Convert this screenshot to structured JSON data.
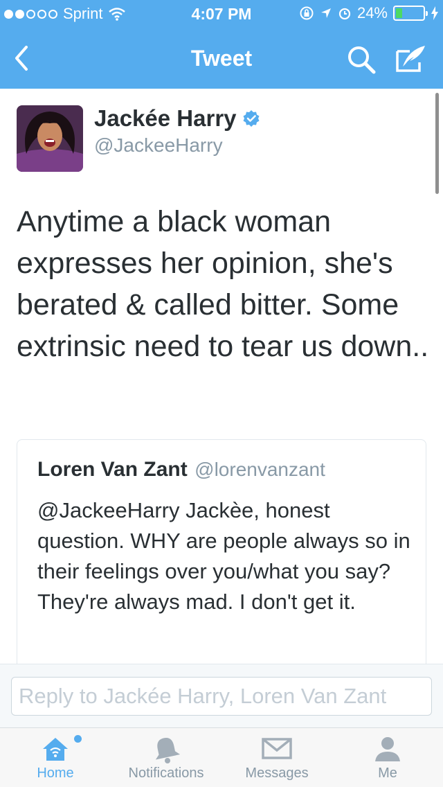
{
  "status_bar": {
    "carrier": "Sprint",
    "time": "4:07 PM",
    "battery_percent": "24%",
    "signal_dots_filled": 2,
    "battery_level": 0.24
  },
  "nav": {
    "title": "Tweet"
  },
  "tweet": {
    "author_name": "Jackée Harry",
    "author_handle": "@JackeeHarry",
    "text": "Anytime a black woman expresses her opinion, she's berated & called bitter. Some extrinsic need to tear us down.."
  },
  "quoted_tweet": {
    "author_name": "Loren Van Zant",
    "author_handle": "@lorenvanzant",
    "text": "@JackeeHarry Jackèe, honest question. WHY are people always so in their feelings over you/what you say? They're always mad. I don't get it."
  },
  "reply": {
    "placeholder": "Reply to Jackée Harry, Loren Van Zant"
  },
  "tabs": [
    {
      "label": "Home",
      "icon": "home-icon",
      "active": true
    },
    {
      "label": "Notifications",
      "icon": "bell-icon",
      "active": false
    },
    {
      "label": "Messages",
      "icon": "envelope-icon",
      "active": false
    },
    {
      "label": "Me",
      "icon": "person-icon",
      "active": false
    }
  ],
  "colors": {
    "brand": "#55acee",
    "text": "#292f33",
    "secondary": "#8899a6",
    "battery": "#4cd964"
  }
}
